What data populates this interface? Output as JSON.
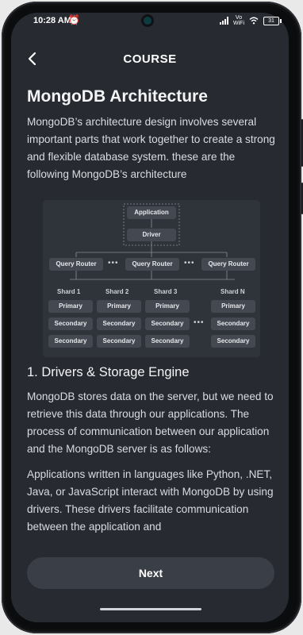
{
  "status": {
    "time": "10:28 AM",
    "battery": "31",
    "vowifi_top": "Vo",
    "vowifi_bottom": "WiFi"
  },
  "header": {
    "title": "COURSE"
  },
  "article": {
    "title": "MongoDB Architecture",
    "intro": "MongoDB’s architecture design involves several important parts that work together to create a strong and flexible database system. these are the following MongoDB’s architecture",
    "section1_title": "1. Drivers & Storage Engine",
    "para1": "MongoDB stores data on the server, but we need to retrieve this data through our applications. The process of communication between our application and the MongoDB server is as follows:",
    "para2": "Applications written in languages like Python, .NET, Java, or JavaScript interact with MongoDB by using drivers. These drivers facilitate communication between the application and"
  },
  "diagram": {
    "application": "Application",
    "driver": "Driver",
    "query_router": "Query Router",
    "shards": [
      "Shard 1",
      "Shard 2",
      "Shard 3",
      "Shard N"
    ],
    "primary": "Primary",
    "secondary": "Secondary",
    "ellipsis": "•••"
  },
  "footer": {
    "next_label": "Next"
  }
}
